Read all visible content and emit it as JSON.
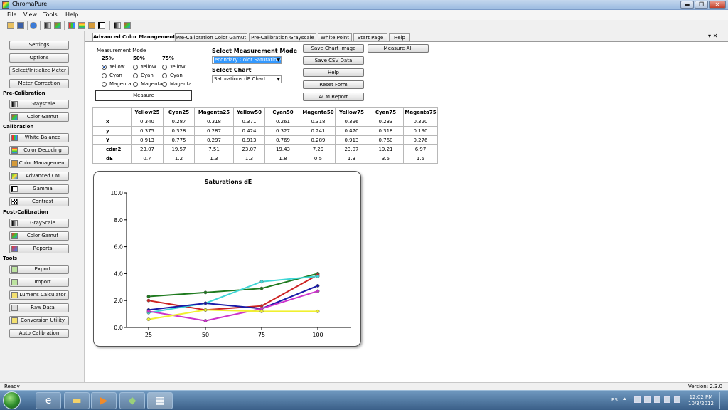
{
  "window": {
    "title": "ChromaPure",
    "min": "▬",
    "max": "❐",
    "close": "✕"
  },
  "menu": [
    "File",
    "View",
    "Tools",
    "Help"
  ],
  "toolbar_icons": [
    "open-icon",
    "save-icon",
    "help-icon",
    "grayscale-icon",
    "gamut-icon",
    "balance-icon",
    "decoding-icon",
    "color-management-icon",
    "gamma-icon",
    "contrast-icon",
    "cie-icon"
  ],
  "sidebar": {
    "top_buttons": [
      "Settings",
      "Options",
      "Select/Initialize Meter",
      "Meter Correction"
    ],
    "pre_calibration": {
      "heading": "Pre-Calibration",
      "buttons": [
        "Grayscale",
        "Color Gamut"
      ]
    },
    "calibration": {
      "heading": "Calibration",
      "buttons": [
        "White Balance",
        "Color Decoding",
        "Color Management",
        "Advanced CM",
        "Gamma",
        "Contrast"
      ]
    },
    "post_calibration": {
      "heading": "Post-Calibration",
      "buttons": [
        "GrayScale",
        "Color Gamut",
        "Reports"
      ]
    },
    "tools": {
      "heading": "Tools",
      "buttons": [
        "Export",
        "Import",
        "Lumens Calculator",
        "Raw Data",
        "Conversion Utility",
        "Auto Calibration"
      ]
    }
  },
  "tabs": [
    "Advanced Color Management",
    "Pre-Calibration Color Gamut",
    "Pre-Calibration Grayscale",
    "White Point",
    "Start Page",
    "Help"
  ],
  "tab_controls": "▾ ✕",
  "measurement_mode": {
    "title": "Measurement Mode",
    "columns": [
      "25%",
      "50%",
      "75%"
    ],
    "options": [
      "Yellow",
      "Cyan",
      "Magenta"
    ],
    "selected": "25% Yellow",
    "measure_button": "Measure"
  },
  "select_mode": {
    "label": "Select Measurement Mode",
    "value": "econdary Color Saturations"
  },
  "select_chart": {
    "label": "Select Chart",
    "value": "Saturations dE Chart"
  },
  "buttons": [
    "Save Chart Image",
    "Save CSV Data",
    "Help",
    "Reset Form",
    "ACM Report"
  ],
  "measure_all": "Measure All",
  "table": {
    "headers": [
      "",
      "Yellow25",
      "Cyan25",
      "Magenta25",
      "Yellow50",
      "Cyan50",
      "Magenta50",
      "Yellow75",
      "Cyan75",
      "Magenta75"
    ],
    "rows": [
      [
        "x",
        "0.340",
        "0.287",
        "0.318",
        "0.371",
        "0.261",
        "0.318",
        "0.396",
        "0.233",
        "0.320"
      ],
      [
        "y",
        "0.375",
        "0.328",
        "0.287",
        "0.424",
        "0.327",
        "0.241",
        "0.470",
        "0.318",
        "0.190"
      ],
      [
        "Y",
        "0.913",
        "0.775",
        "0.297",
        "0.913",
        "0.769",
        "0.289",
        "0.913",
        "0.760",
        "0.276"
      ],
      [
        "cdm2",
        "23.07",
        "19.57",
        "7.51",
        "23.07",
        "19.43",
        "7.29",
        "23.07",
        "19.21",
        "6.97"
      ],
      [
        "dE",
        "0.7",
        "1.2",
        "1.3",
        "1.3",
        "1.8",
        "0.5",
        "1.3",
        "3.5",
        "1.5"
      ]
    ]
  },
  "chart_data": {
    "type": "line",
    "title": "Saturations dE",
    "categories": [
      "25",
      "50",
      "75",
      "100"
    ],
    "ylim": [
      0,
      10
    ],
    "yticks": [
      "0.0",
      "2.0",
      "4.0",
      "6.0",
      "8.0",
      "10.0"
    ],
    "grid": false,
    "legend": "none",
    "series": [
      {
        "color": "#1e7a1e",
        "values": [
          2.3,
          2.6,
          2.9,
          4.0
        ]
      },
      {
        "color": "#cc2222",
        "values": [
          2.0,
          1.3,
          1.6,
          3.9
        ]
      },
      {
        "color": "#3fd6d6",
        "values": [
          1.1,
          1.8,
          3.4,
          3.8
        ]
      },
      {
        "color": "#1a1aa8",
        "values": [
          1.3,
          1.8,
          1.4,
          3.1
        ]
      },
      {
        "color": "#cc33cc",
        "values": [
          1.2,
          0.5,
          1.4,
          2.7
        ]
      },
      {
        "color": "#f0f030",
        "values": [
          0.6,
          1.3,
          1.2,
          1.2
        ]
      }
    ]
  },
  "status": {
    "left": "Ready",
    "right": "Version: 2.3.0"
  },
  "taskbar": {
    "lang": "ES",
    "time": "12:02 PM",
    "date": "10/3/2012"
  }
}
